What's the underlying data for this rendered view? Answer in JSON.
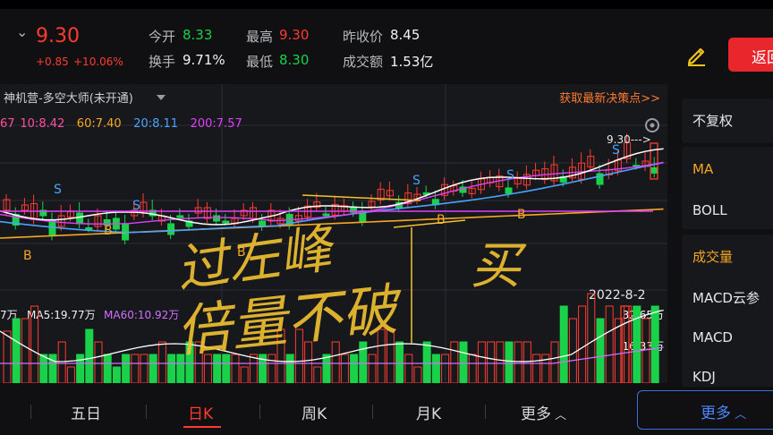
{
  "quote": {
    "price": "9.30",
    "change": "+0.85",
    "change_pct": "+10.06%",
    "open_label": "今开",
    "open": "8.33",
    "high_label": "最高",
    "high": "9.30",
    "prev_close_label": "昨收价",
    "prev_close": "8.45",
    "turnover_label": "换手",
    "turnover": "9.71%",
    "low_label": "最低",
    "low": "8.30",
    "amount_label": "成交额",
    "amount": "1.53亿"
  },
  "header": {
    "back_label": "返回"
  },
  "chart": {
    "indicator_name": "神机营-多空大师(未开通)",
    "promo_link": "获取最新决策点>>",
    "ma_legend": [
      {
        "text": "67",
        "color": "#ff4fa0"
      },
      {
        "text": "10:8.42",
        "color": "#ff4fa0"
      },
      {
        "text": "60:7.40",
        "color": "#f6a623"
      },
      {
        "text": "20:8.11",
        "color": "#4aa3ff"
      },
      {
        "text": "200:7.57",
        "color": "#e040fb"
      }
    ],
    "price_tag": "9.30--->",
    "date_label": "2022-8-2",
    "vol_legend": [
      {
        "text": "7万",
        "color": "#f2f2f2"
      },
      {
        "text": "MA5:19.77万",
        "color": "#f2f2f2"
      },
      {
        "text": "MA60:10.92万",
        "color": "#d070ff"
      }
    ],
    "vol_max": "32.65万",
    "vol_mid": "16.33万",
    "signal_s": "S",
    "signal_b": "B"
  },
  "annotations": {
    "top_text": "过左峰",
    "bottom_text": "倍量不破",
    "right_text": "买"
  },
  "right_panel": {
    "top_items": [
      "不复权"
    ],
    "mid_items": [
      "MA",
      "BOLL"
    ],
    "bottom_items": [
      "成交量",
      "MACD云参",
      "MACD",
      "KDJ"
    ],
    "active_color": "#f6a623"
  },
  "tabs": {
    "items": [
      "五日",
      "日K",
      "周K",
      "月K",
      "更多"
    ],
    "active": "日K",
    "more_button": "更多"
  },
  "colors": {
    "up": "#ff3b30",
    "down": "#19d24a",
    "accent": "#e8262b",
    "link": "#4d86ff"
  }
}
